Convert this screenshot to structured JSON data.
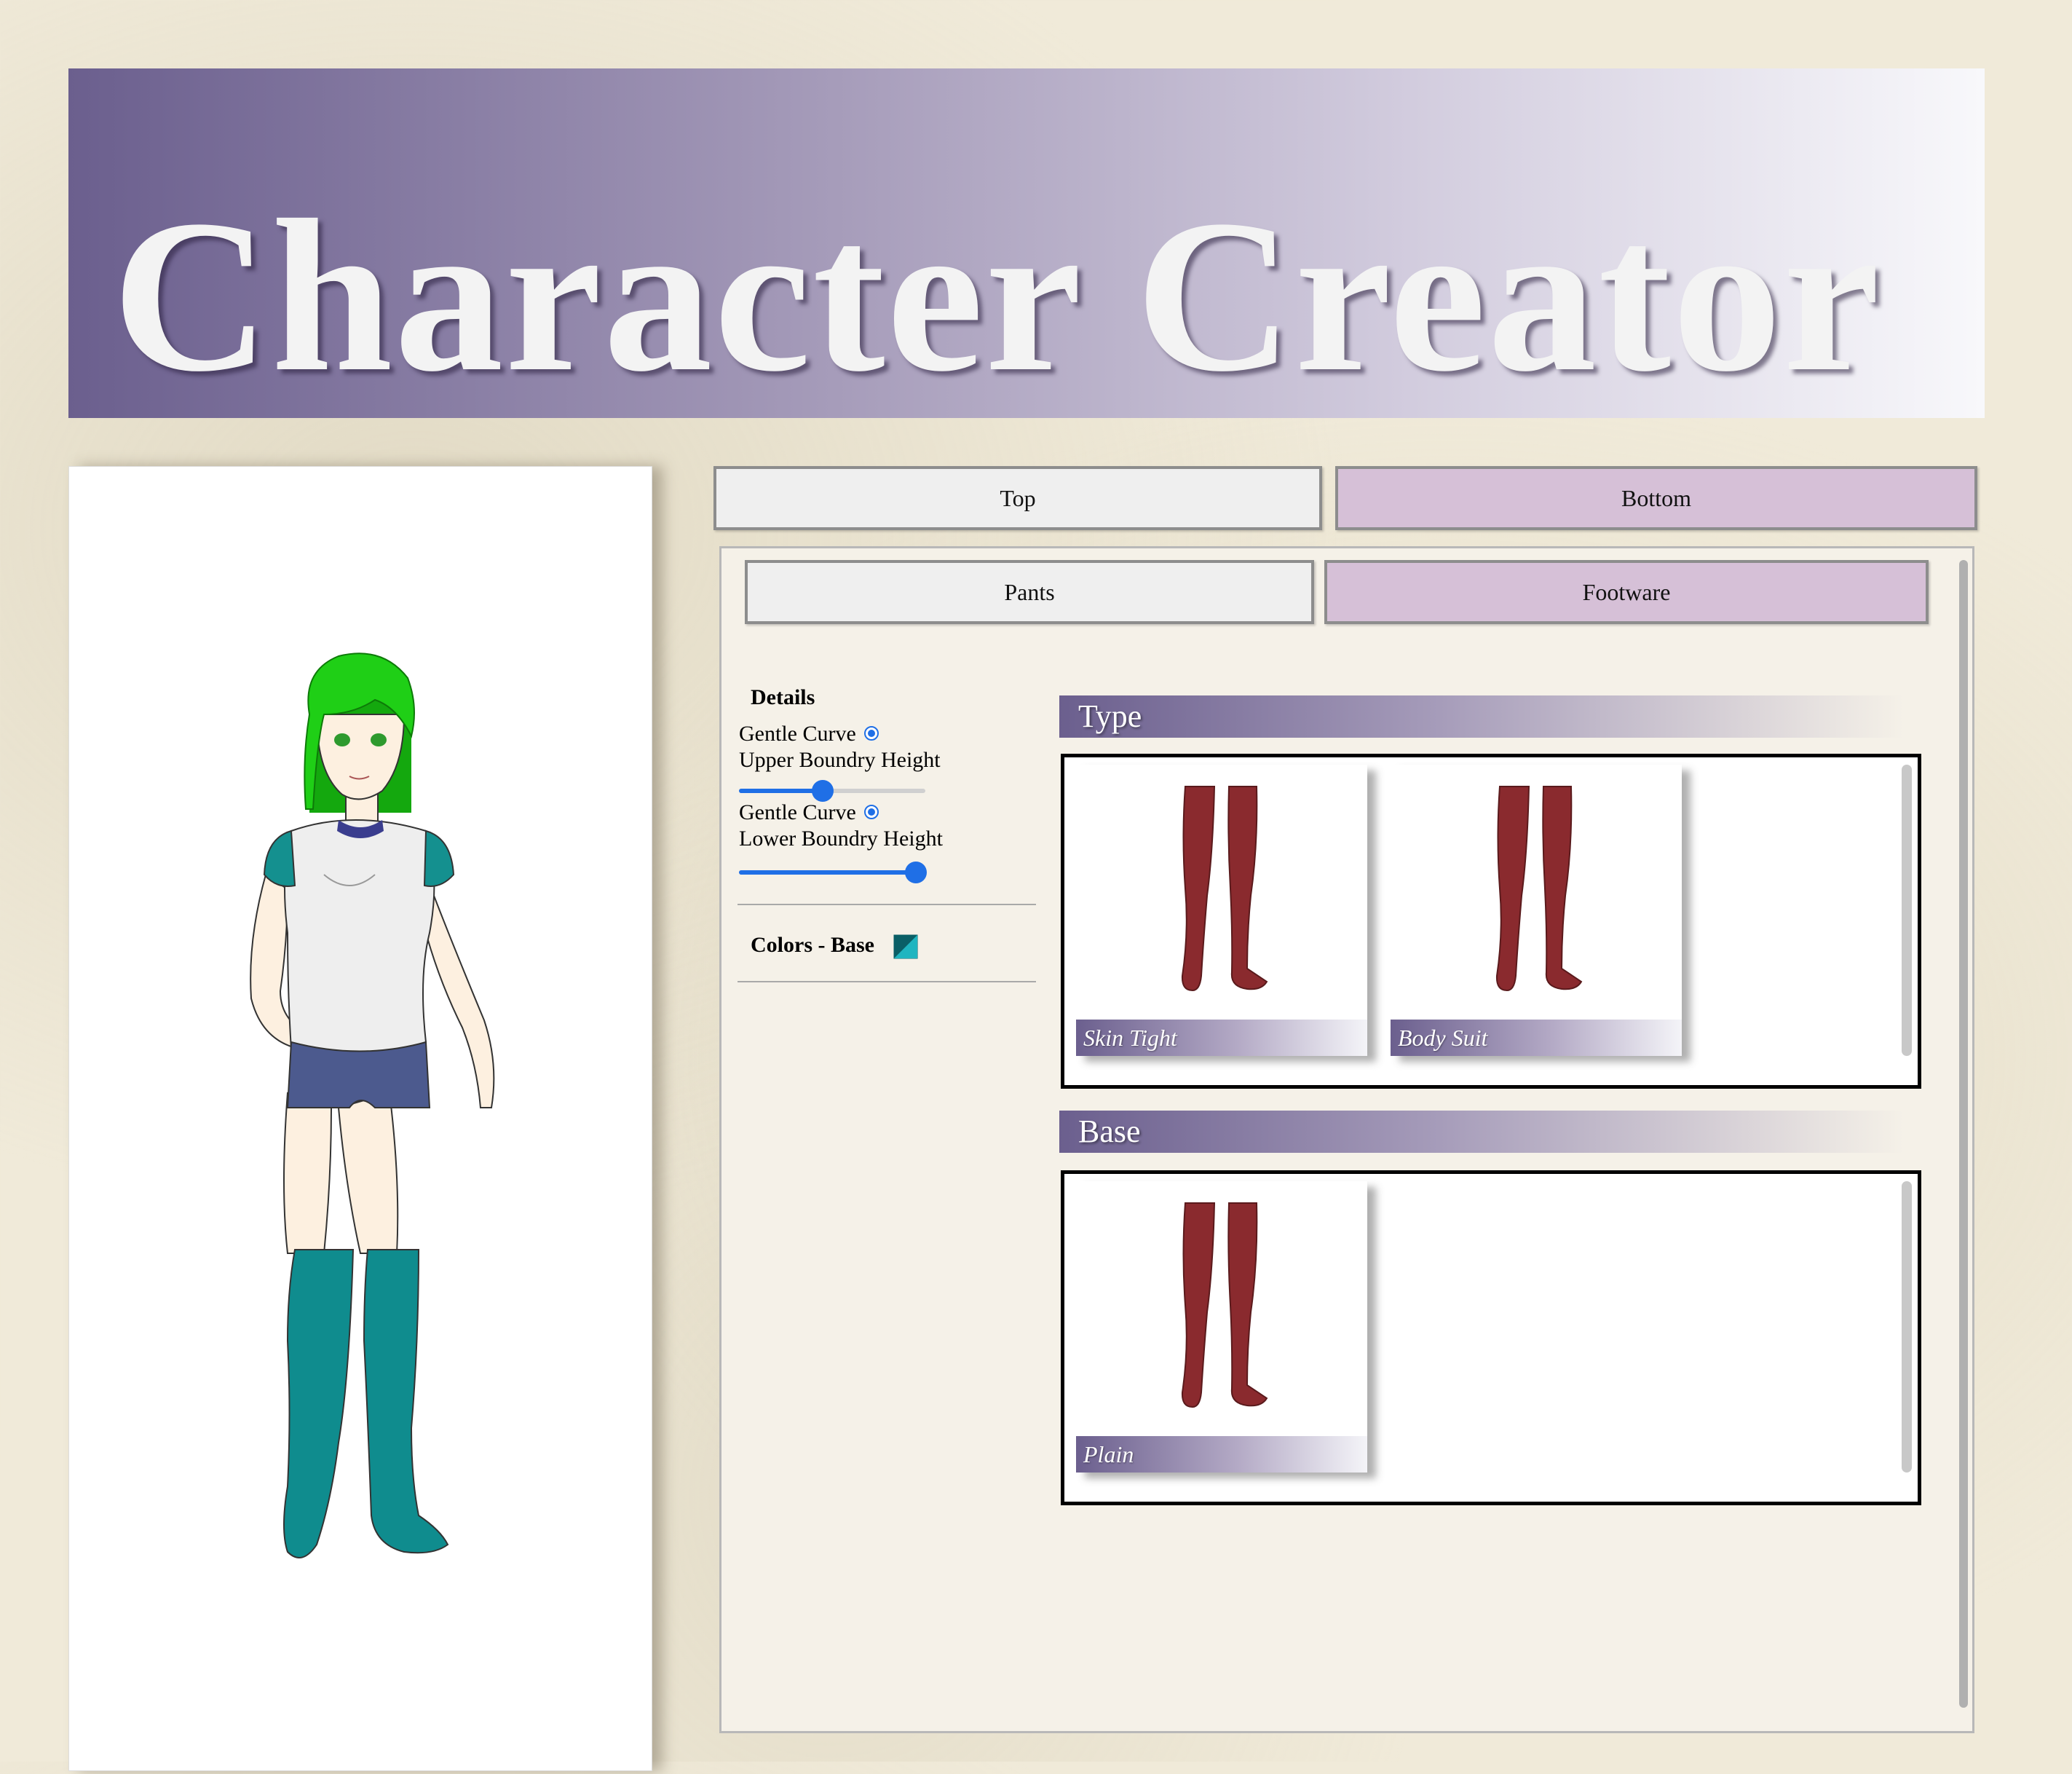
{
  "header": {
    "title": "Character Creator"
  },
  "main_tabs": [
    {
      "label": "Top",
      "active": false
    },
    {
      "label": "Bottom",
      "active": true
    }
  ],
  "sub_tabs": [
    {
      "label": "Pants",
      "active": false
    },
    {
      "label": "Footware",
      "active": true
    }
  ],
  "details": {
    "title": "Details",
    "upper": {
      "option": "Gentle Curve",
      "label": "Upper Boundry Height",
      "value": 0.45
    },
    "lower": {
      "option": "Gentle Curve",
      "label": "Lower Boundry Height",
      "value": 0.95
    },
    "colors_label": "Colors - Base"
  },
  "sections": {
    "type": {
      "title": "Type",
      "items": [
        {
          "label": "Skin Tight"
        },
        {
          "label": "Body Suit"
        }
      ]
    },
    "base": {
      "title": "Base",
      "items": [
        {
          "label": "Plain"
        }
      ]
    }
  },
  "colors": {
    "accent": "#6b5f8e",
    "active_tab": "#d6c0d7",
    "slider": "#1f6fe6",
    "hair": "#1fcf16",
    "boots": "#0f8c8e",
    "shorts": "#4c5a8e",
    "socks_preview": "#8a2a2e"
  }
}
